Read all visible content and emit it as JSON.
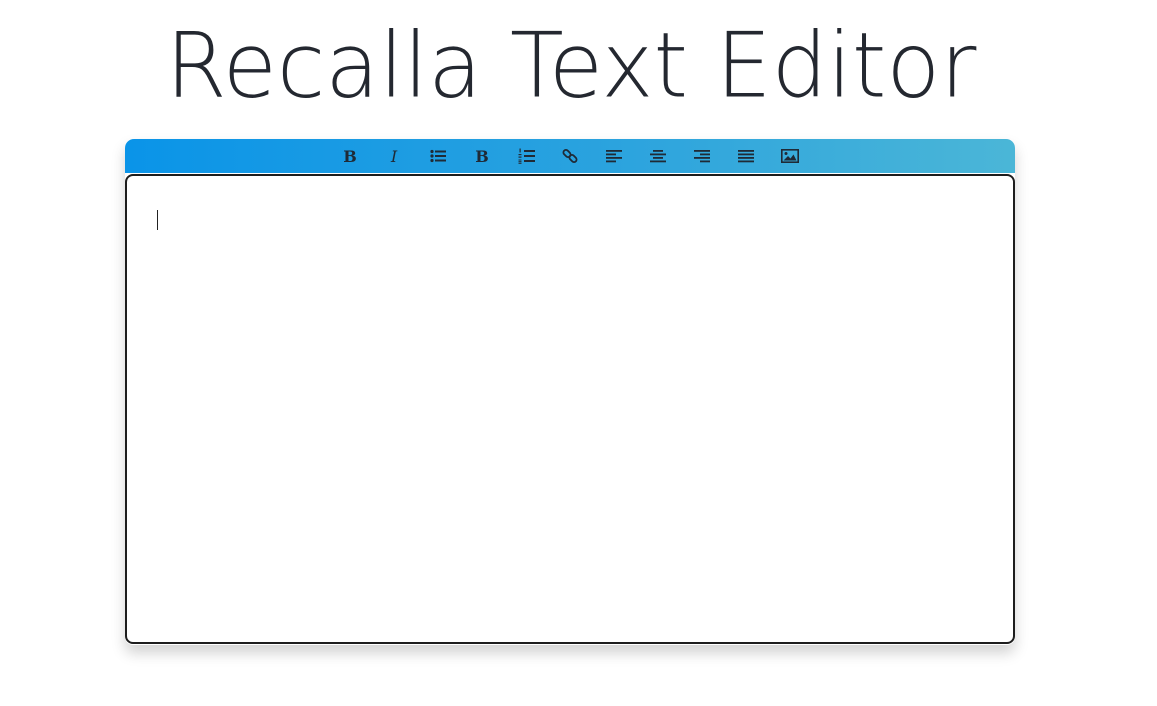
{
  "app": {
    "title": "Recalla Text Editor"
  },
  "toolbar": {
    "buttons": [
      {
        "id": "bold",
        "glyph": "B",
        "icon": "bold-icon"
      },
      {
        "id": "italic",
        "glyph": "I",
        "icon": "italic-icon"
      },
      {
        "id": "bullet-list",
        "icon": "bullet-list-icon"
      },
      {
        "id": "bold-alt",
        "glyph": "B",
        "icon": "bold-icon"
      },
      {
        "id": "numbered-list",
        "icon": "numbered-list-icon"
      },
      {
        "id": "link",
        "icon": "link-icon"
      },
      {
        "id": "align-left",
        "icon": "align-left-icon"
      },
      {
        "id": "align-center",
        "icon": "align-center-icon"
      },
      {
        "id": "align-right",
        "icon": "align-right-icon"
      },
      {
        "id": "align-justify",
        "icon": "align-justify-icon"
      },
      {
        "id": "image",
        "icon": "image-icon"
      }
    ]
  },
  "editor": {
    "content": ""
  },
  "colors": {
    "toolbar_start": "#0a94e8",
    "toolbar_end": "#4bb6d7",
    "title_text": "#242830",
    "icon": "#1f2a36",
    "border": "#1d1d1d"
  }
}
